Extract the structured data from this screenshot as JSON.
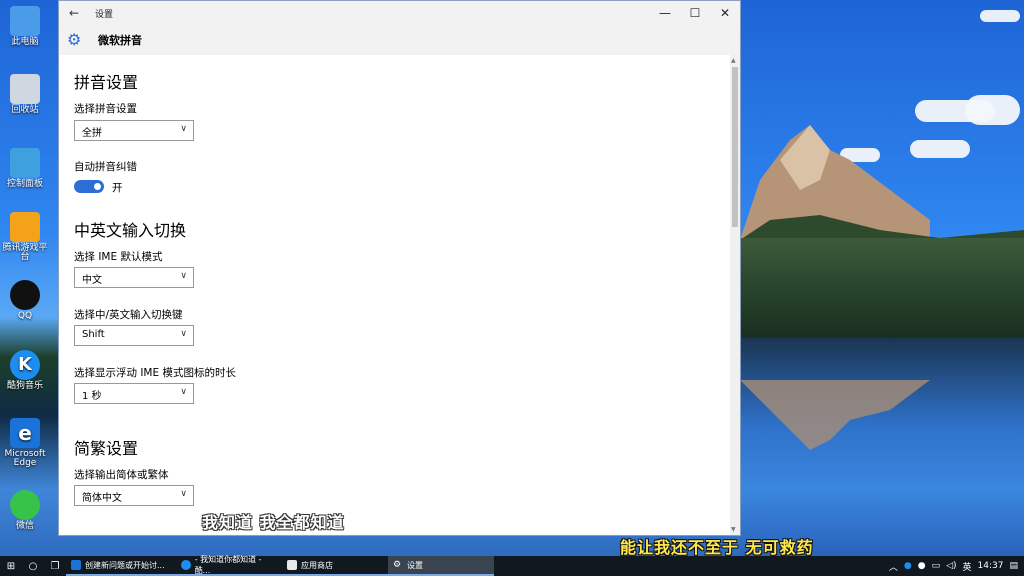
{
  "desktop": {
    "icons": [
      {
        "label": "此电脑",
        "icon": "computer-icon",
        "color": "#4a9be8"
      },
      {
        "label": "回收站",
        "icon": "recycle-bin-icon",
        "color": "#cfd8e0"
      },
      {
        "label": "控制面板",
        "icon": "control-panel-icon",
        "color": "#3fa0e0"
      },
      {
        "label": "腾讯游戏平台",
        "icon": "tencent-games-icon",
        "color": "#f3a21a"
      },
      {
        "label": "QQ",
        "icon": "qq-icon",
        "color": "#000000"
      },
      {
        "label": "酷狗音乐",
        "icon": "kugou-icon",
        "color": "#1d8ef0"
      },
      {
        "label": "Microsoft Edge",
        "icon": "edge-icon",
        "color": "#1a73d8"
      },
      {
        "label": "微信",
        "icon": "wechat-icon",
        "color": "#37c24a"
      }
    ]
  },
  "window": {
    "title": "设置",
    "header_title": "微软拼音",
    "controls": {
      "back": "←",
      "minimize": "—",
      "maximize": "☐",
      "close": "✕"
    }
  },
  "settings": {
    "pinyin_section": "拼音设置",
    "pinyin_mode_label": "选择拼音设置",
    "pinyin_mode_value": "全拼",
    "auto_correct_label": "自动拼音纠错",
    "auto_correct_state": "开",
    "switch_section": "中英文输入切换",
    "ime_mode_label": "选择 IME 默认模式",
    "ime_mode_value": "中文",
    "switch_key_label": "选择中/英文输入切换键",
    "switch_key_value": "Shift",
    "float_duration_label": "选择显示浮动 IME 模式图标的时长",
    "float_duration_value": "1 秒",
    "trad_section": "简繁设置",
    "output_label": "选择输出简体或繁体",
    "output_value": "简体中文"
  },
  "subtitles": {
    "white": "我知道 我全都知道",
    "yellow": "能让我还不至于 无可救药"
  },
  "taskbar": {
    "tasks": [
      {
        "label": "创建新问题或开始讨...",
        "icon": "edge-icon"
      },
      {
        "label": "- 我知道你都知道 - 酷...",
        "icon": "kugou-icon"
      },
      {
        "label": "应用商店",
        "icon": "store-icon"
      },
      {
        "label": "设置",
        "icon": "gear-icon"
      }
    ],
    "lang": "英",
    "time": "14:37"
  },
  "colors": {
    "accent": "#2b6fd6",
    "subtitle_yellow": "#ffe94a"
  }
}
